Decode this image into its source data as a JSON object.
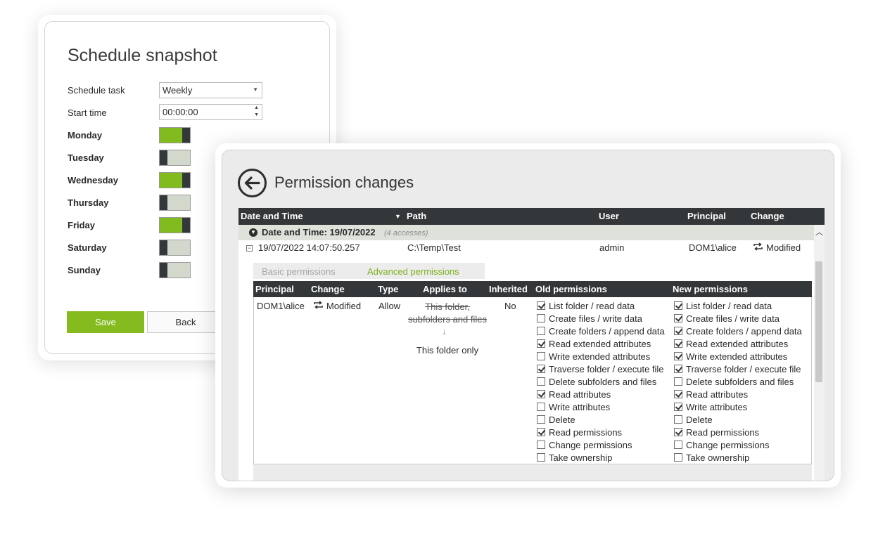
{
  "schedule": {
    "title": "Schedule snapshot",
    "task_label": "Schedule task",
    "task_value": "Weekly",
    "start_label": "Start time",
    "start_value": "00:00:00",
    "days": [
      {
        "label": "Monday",
        "on": true
      },
      {
        "label": "Tuesday",
        "on": false
      },
      {
        "label": "Wednesday",
        "on": true
      },
      {
        "label": "Thursday",
        "on": false
      },
      {
        "label": "Friday",
        "on": true
      },
      {
        "label": "Saturday",
        "on": false
      },
      {
        "label": "Sunday",
        "on": false
      }
    ],
    "save_label": "Save",
    "back_label": "Back",
    "colors": {
      "accent": "#85bb1f",
      "knob": "#33383a",
      "toggle_off": "#d3d8cc"
    }
  },
  "permissions": {
    "title": "Permission changes",
    "back_icon": "arrow-left-circle-icon",
    "columns": {
      "datetime": "Date and Time",
      "path": "Path",
      "user": "User",
      "principal": "Principal",
      "change": "Change"
    },
    "group": {
      "label": "Date and Time: 19/07/2022",
      "count": "(4 accesses)"
    },
    "row": {
      "datetime": "19/07/2022 14:07:50.257",
      "path": "C:\\Temp\\Test",
      "user": "admin",
      "principal": "DOM1\\alice",
      "change": "Modified"
    },
    "tabs": {
      "basic": "Basic permissions",
      "advanced": "Advanced permissions"
    },
    "detail_columns": {
      "principal": "Principal",
      "change": "Change",
      "type": "Type",
      "applies": "Applies to",
      "inherited": "Inherited",
      "old": "Old permissions",
      "new": "New permissions"
    },
    "detail": {
      "principal": "DOM1\\alice",
      "change": "Modified",
      "type": "Allow",
      "applies_old": "This folder, subfolders and files",
      "applies_new": "This folder only",
      "inherited": "No"
    },
    "perm_names": [
      "List folder / read data",
      "Create files / write data",
      "Create folders / append data",
      "Read extended attributes",
      "Write extended attributes",
      "Traverse folder / execute file",
      "Delete subfolders and files",
      "Read attributes",
      "Write attributes",
      "Delete",
      "Read permissions",
      "Change permissions",
      "Take ownership"
    ],
    "old_checked": [
      true,
      false,
      false,
      true,
      false,
      true,
      false,
      true,
      false,
      false,
      true,
      false,
      false
    ],
    "new_checked": [
      true,
      true,
      true,
      true,
      true,
      true,
      false,
      true,
      true,
      false,
      true,
      false,
      false
    ],
    "colors": {
      "header_bg": "#343739",
      "group_bg": "#dfe2db",
      "tab_active": "#7cb01c"
    }
  }
}
